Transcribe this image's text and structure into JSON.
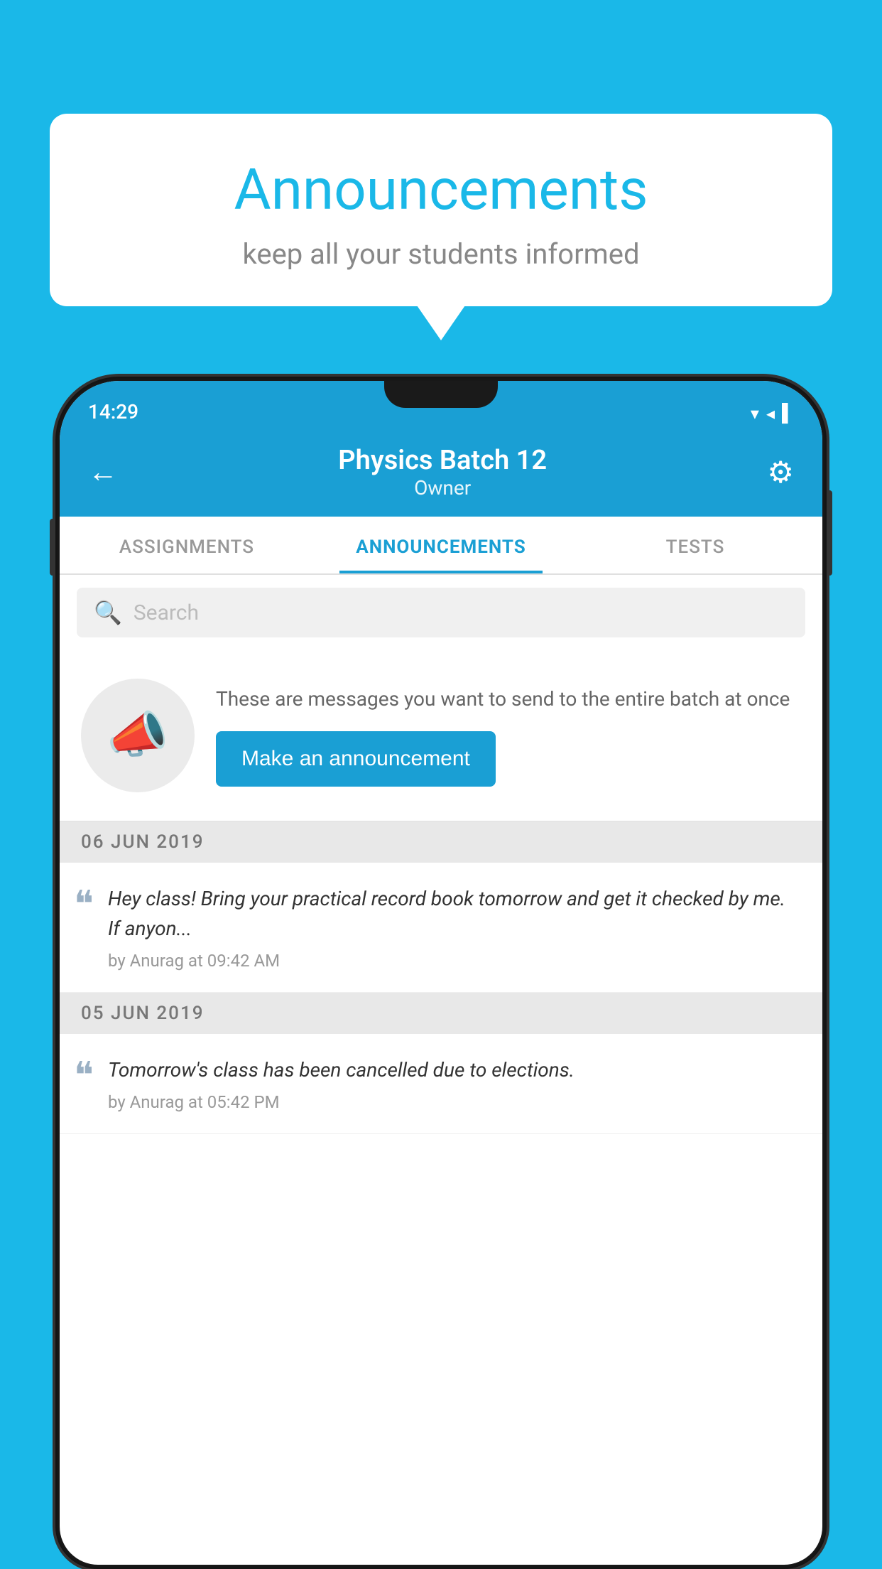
{
  "background": {
    "color": "#1ab8e8"
  },
  "speech_bubble": {
    "title": "Announcements",
    "subtitle": "keep all your students informed"
  },
  "phone": {
    "status_bar": {
      "time": "14:29",
      "icons": [
        "▾",
        "◂",
        "▌"
      ]
    },
    "header": {
      "back_label": "←",
      "title": "Physics Batch 12",
      "subtitle": "Owner",
      "gear_label": "⚙"
    },
    "tabs": [
      {
        "label": "ASSIGNMENTS",
        "active": false
      },
      {
        "label": "ANNOUNCEMENTS",
        "active": true
      },
      {
        "label": "TESTS",
        "active": false
      }
    ],
    "search": {
      "placeholder": "Search"
    },
    "cta": {
      "description": "These are messages you want to send to the entire batch at once",
      "button_label": "Make an announcement"
    },
    "announcements": [
      {
        "date": "06  JUN  2019",
        "text": "Hey class! Bring your practical record book tomorrow and get it checked by me. If anyon...",
        "meta": "by Anurag at 09:42 AM"
      },
      {
        "date": "05  JUN  2019",
        "text": "Tomorrow's class has been cancelled due to elections.",
        "meta": "by Anurag at 05:42 PM"
      }
    ]
  }
}
